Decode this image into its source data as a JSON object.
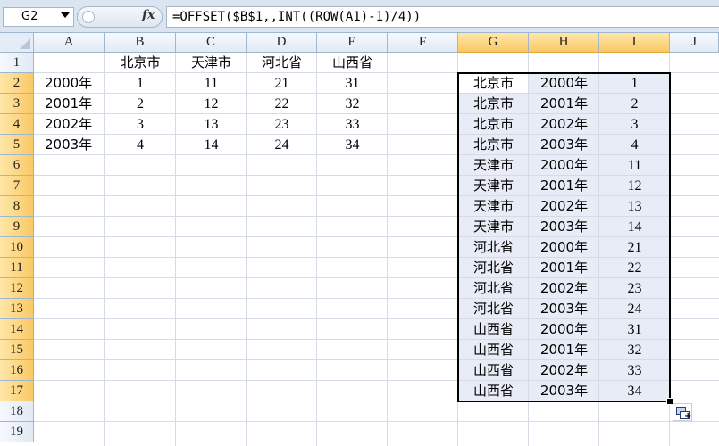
{
  "formula_bar": {
    "name_box": "G2",
    "fx_label": "fx",
    "formula": "=OFFSET($B$1,,INT((ROW(A1)-1)/4))"
  },
  "columns": [
    "A",
    "B",
    "C",
    "D",
    "E",
    "F",
    "G",
    "H",
    "I",
    "J"
  ],
  "rows": [
    "1",
    "2",
    "3",
    "4",
    "5",
    "6",
    "7",
    "8",
    "9",
    "10",
    "11",
    "12",
    "13",
    "14",
    "15",
    "16",
    "17",
    "18",
    "19"
  ],
  "selected_column_headers": [
    "G",
    "H",
    "I"
  ],
  "selected_row_headers": [
    "2",
    "3",
    "4",
    "5",
    "6",
    "7",
    "8",
    "9",
    "10",
    "11",
    "12",
    "13",
    "14",
    "15",
    "16",
    "17"
  ],
  "source_table": {
    "headers": [
      "北京市",
      "天津市",
      "河北省",
      "山西省"
    ],
    "rows": [
      {
        "year": "2000年",
        "values": [
          "1",
          "11",
          "21",
          "31"
        ]
      },
      {
        "year": "2001年",
        "values": [
          "2",
          "12",
          "22",
          "32"
        ]
      },
      {
        "year": "2002年",
        "values": [
          "3",
          "13",
          "23",
          "33"
        ]
      },
      {
        "year": "2003年",
        "values": [
          "4",
          "14",
          "24",
          "34"
        ]
      }
    ]
  },
  "result_table": [
    {
      "region": "北京市",
      "year": "2000年",
      "value": "1"
    },
    {
      "region": "北京市",
      "year": "2001年",
      "value": "2"
    },
    {
      "region": "北京市",
      "year": "2002年",
      "value": "3"
    },
    {
      "region": "北京市",
      "year": "2003年",
      "value": "4"
    },
    {
      "region": "天津市",
      "year": "2000年",
      "value": "11"
    },
    {
      "region": "天津市",
      "year": "2001年",
      "value": "12"
    },
    {
      "region": "天津市",
      "year": "2002年",
      "value": "13"
    },
    {
      "region": "天津市",
      "year": "2003年",
      "value": "14"
    },
    {
      "region": "河北省",
      "year": "2000年",
      "value": "21"
    },
    {
      "region": "河北省",
      "year": "2001年",
      "value": "22"
    },
    {
      "region": "河北省",
      "year": "2002年",
      "value": "23"
    },
    {
      "region": "河北省",
      "year": "2003年",
      "value": "24"
    },
    {
      "region": "山西省",
      "year": "2000年",
      "value": "31"
    },
    {
      "region": "山西省",
      "year": "2001年",
      "value": "32"
    },
    {
      "region": "山西省",
      "year": "2002年",
      "value": "33"
    },
    {
      "region": "山西省",
      "year": "2003年",
      "value": "34"
    }
  ],
  "icons": {
    "name_dropdown": "chevron-down-icon",
    "function": "fx-icon",
    "autofill": "autofill-options-icon"
  },
  "colors": {
    "header_bg": "#e2eaf5",
    "selected_header": "#f9c966",
    "selection_fill": "#e8ecf6",
    "gridline": "#d4dbe5"
  }
}
